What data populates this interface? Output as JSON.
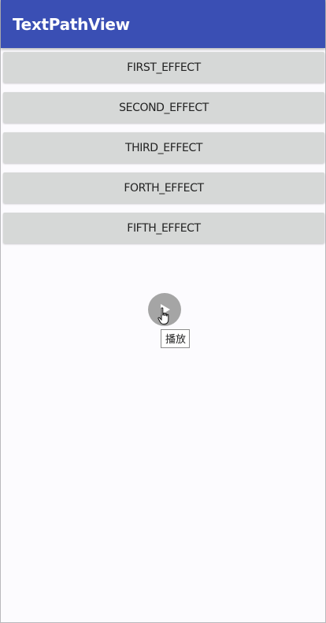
{
  "app_bar": {
    "title": "TextPathView"
  },
  "buttons": [
    {
      "label": "FIRST_EFFECT"
    },
    {
      "label": "SECOND_EFFECT"
    },
    {
      "label": "THIRD_EFFECT"
    },
    {
      "label": "FORTH_EFFECT"
    },
    {
      "label": "FIFTH_EFFECT"
    }
  ],
  "player": {
    "play_icon": "play-icon",
    "cursor_icon": "hand-pointer-icon",
    "tooltip": "播放"
  },
  "colors": {
    "app_bar": "#3a4fb4",
    "button_bg": "#d6d8d7",
    "background": "#fcfbfe",
    "play_button": "#a5a5a5"
  }
}
